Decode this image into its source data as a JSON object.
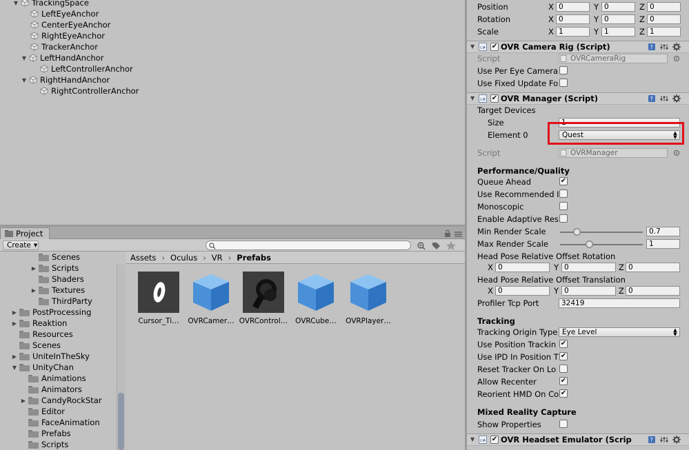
{
  "hierarchy": {
    "items": [
      {
        "label": "TrackingSpace",
        "expanded": true
      },
      {
        "label": "LeftEyeAnchor"
      },
      {
        "label": "CenterEyeAnchor"
      },
      {
        "label": "RightEyeAnchor"
      },
      {
        "label": "TrackerAnchor"
      },
      {
        "label": "LeftHandAnchor",
        "expanded": true
      },
      {
        "label": "LeftControllerAnchor"
      },
      {
        "label": "RightHandAnchor",
        "expanded": true
      },
      {
        "label": "RightControllerAnchor"
      }
    ]
  },
  "project": {
    "tab_label": "Project",
    "create_label": "Create",
    "search": {
      "value": ""
    },
    "tree": [
      {
        "label": "Scenes"
      },
      {
        "label": "Scripts"
      },
      {
        "label": "Shaders"
      },
      {
        "label": "Textures"
      },
      {
        "label": "ThirdParty"
      },
      {
        "label": "PostProcessing"
      },
      {
        "label": "Reaktion"
      },
      {
        "label": "Resources"
      },
      {
        "label": "Scenes"
      },
      {
        "label": "UniteInTheSky"
      },
      {
        "label": "UnityChan"
      },
      {
        "label": "Animations"
      },
      {
        "label": "Animators"
      },
      {
        "label": "CandyRockStar"
      },
      {
        "label": "Editor"
      },
      {
        "label": "FaceAnimation"
      },
      {
        "label": "Prefabs"
      },
      {
        "label": "Scripts"
      }
    ],
    "breadcrumb": [
      "Assets",
      "Oculus",
      "VR",
      "Prefabs"
    ],
    "assets": [
      {
        "label": "Cursor_Ti…",
        "icon": "cursor-timer-prefab-icon"
      },
      {
        "label": "OVRCamer…",
        "icon": "cube-prefab-icon"
      },
      {
        "label": "OVRControl…",
        "icon": "controller-prefab-icon"
      },
      {
        "label": "OVRCube…",
        "icon": "cube-prefab-icon"
      },
      {
        "label": "OVRPlayer…",
        "icon": "cube-prefab-icon"
      }
    ]
  },
  "inspector": {
    "transform": {
      "position_label": "Position",
      "rotation_label": "Rotation",
      "scale_label": "Scale",
      "position": {
        "x": "0",
        "y": "0",
        "z": "0"
      },
      "rotation": {
        "x": "0",
        "y": "0",
        "z": "0"
      },
      "scale": {
        "x": "1",
        "y": "1",
        "z": "1"
      }
    },
    "camera_rig": {
      "title": "OVR Camera Rig (Script)",
      "script_label": "Script",
      "script_value": "OVRCameraRig",
      "use_per_eye_label": "Use Per Eye Camera",
      "use_fixed_update_label": "Use Fixed Update Fo"
    },
    "manager": {
      "title": "OVR Manager (Script)",
      "target_devices_label": "Target Devices",
      "size_label": "Size",
      "size_value": "1",
      "element0_label": "Element 0",
      "element0_value": "Quest",
      "script_label": "Script",
      "script_value": "OVRManager",
      "perf_section": "Performance/Quality",
      "queue_ahead_label": "Queue Ahead",
      "use_recommended_label": "Use Recommended I",
      "monoscopic_label": "Monoscopic",
      "adaptive_label": "Enable Adaptive Res",
      "min_render_label": "Min Render Scale",
      "min_render_value": "0.7",
      "min_render_level": 0.2,
      "max_render_label": "Max Render Scale",
      "max_render_value": "1",
      "max_render_level": 0.35,
      "head_rot_label": "Head Pose Relative Offset Rotation",
      "head_rot": {
        "x": "0",
        "y": "0",
        "z": "0"
      },
      "head_trans_label": "Head Pose Relative Offset Translation",
      "head_trans": {
        "x": "0",
        "y": "0",
        "z": "0"
      },
      "profiler_label": "Profiler Tcp Port",
      "profiler_value": "32419",
      "tracking_section": "Tracking",
      "tracking_origin_label": "Tracking Origin Type",
      "tracking_origin_value": "Eye Level",
      "use_position_label": "Use Position Trackin",
      "use_ipd_label": "Use IPD In Position T",
      "reset_tracker_label": "Reset Tracker On Lo",
      "allow_recenter_label": "Allow Recenter",
      "reorient_label": "Reorient HMD On Co",
      "mixed_section": "Mixed Reality Capture",
      "show_properties_label": "Show Properties"
    },
    "headset_emulator": {
      "title": "OVR Headset Emulator (Scrip"
    },
    "axis": {
      "x": "X",
      "y": "Y",
      "z": "Z"
    },
    "colors": {
      "highlight": "#e0101a",
      "cube": "#4a90d9"
    }
  }
}
